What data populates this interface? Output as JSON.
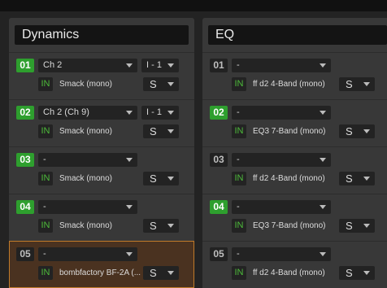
{
  "dynamics": {
    "title": "Dynamics",
    "rows": [
      {
        "num": "01",
        "active": true,
        "input": "Ch 2",
        "bus": "I - 1",
        "in_label": "IN",
        "plugin": "Smack (mono)",
        "mode": "S"
      },
      {
        "num": "02",
        "active": true,
        "input": "Ch 2 (Ch 9)",
        "bus": "I - 1",
        "in_label": "IN",
        "plugin": "Smack (mono)",
        "mode": "S"
      },
      {
        "num": "03",
        "active": true,
        "input": "-",
        "bus": "",
        "in_label": "IN",
        "plugin": "Smack (mono)",
        "mode": "S"
      },
      {
        "num": "04",
        "active": true,
        "input": "-",
        "bus": "",
        "in_label": "IN",
        "plugin": "Smack (mono)",
        "mode": "S"
      },
      {
        "num": "05",
        "active": false,
        "selected": true,
        "input": "-",
        "bus": "",
        "in_label": "IN",
        "plugin": "bombfactory BF-2A (...",
        "mode": "S"
      }
    ]
  },
  "eq": {
    "title": "EQ",
    "rows": [
      {
        "num": "01",
        "active": false,
        "input": "-",
        "in_label": "IN",
        "plugin": "ff d2 4-Band (mono)",
        "mode": "S"
      },
      {
        "num": "02",
        "active": true,
        "input": "-",
        "in_label": "IN",
        "plugin": "EQ3 7-Band (mono)",
        "mode": "S"
      },
      {
        "num": "03",
        "active": false,
        "input": "-",
        "in_label": "IN",
        "plugin": "ff d2 4-Band (mono)",
        "mode": "S"
      },
      {
        "num": "04",
        "active": true,
        "input": "-",
        "in_label": "IN",
        "plugin": "EQ3 7-Band (mono)",
        "mode": "S"
      },
      {
        "num": "05",
        "active": false,
        "input": "-",
        "in_label": "IN",
        "plugin": "ff d2 4-Band (mono)",
        "mode": "S"
      }
    ]
  },
  "colors": {
    "active_green": "#2e9f2e",
    "in_green": "#4dbb3a",
    "selected_border": "#c07a2a"
  }
}
